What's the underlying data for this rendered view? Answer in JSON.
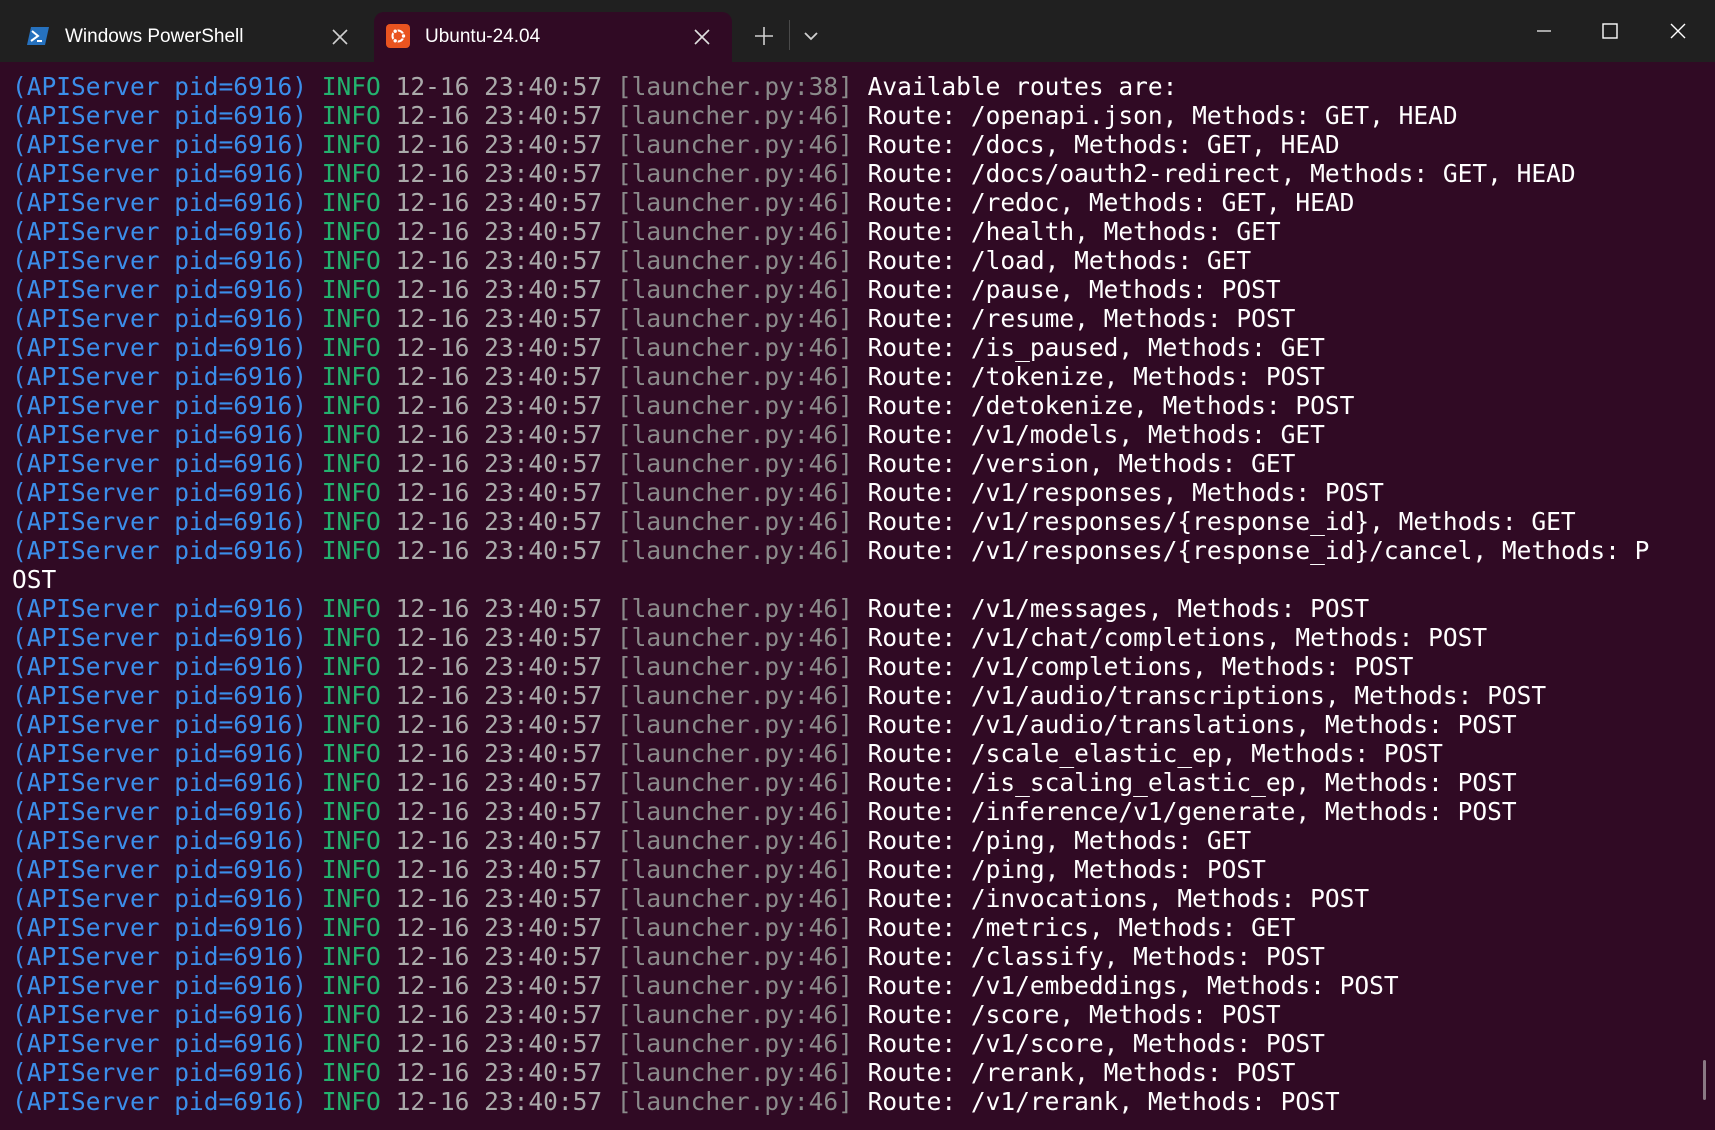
{
  "tabs": [
    {
      "label": "Windows PowerShell",
      "icon": "powershell-icon",
      "active": false
    },
    {
      "label": "Ubuntu-24.04",
      "icon": "ubuntu-icon",
      "active": true
    }
  ],
  "titlebar": {
    "new_tab_icon": "plus-icon",
    "dropdown_icon": "chevron-down-icon",
    "controls": [
      "minimize-icon",
      "maximize-icon",
      "close-icon"
    ]
  },
  "colors": {
    "terminal_bg": "#300a24",
    "titlebar_bg": "#202020",
    "source": "#3b8eea",
    "level": "#23b26e",
    "timestamp": "#aaaaaa",
    "location": "#8b8b8b",
    "message": "#ffffff"
  },
  "log": {
    "source": "(APIServer pid=6916)",
    "level": "INFO",
    "timestamp": "12-16 23:40:57",
    "lines": [
      {
        "location": "[launcher.py:38]",
        "message": "Available routes are:"
      },
      {
        "location": "[launcher.py:46]",
        "message": "Route: /openapi.json, Methods: GET, HEAD"
      },
      {
        "location": "[launcher.py:46]",
        "message": "Route: /docs, Methods: GET, HEAD"
      },
      {
        "location": "[launcher.py:46]",
        "message": "Route: /docs/oauth2-redirect, Methods: GET, HEAD"
      },
      {
        "location": "[launcher.py:46]",
        "message": "Route: /redoc, Methods: GET, HEAD"
      },
      {
        "location": "[launcher.py:46]",
        "message": "Route: /health, Methods: GET"
      },
      {
        "location": "[launcher.py:46]",
        "message": "Route: /load, Methods: GET"
      },
      {
        "location": "[launcher.py:46]",
        "message": "Route: /pause, Methods: POST"
      },
      {
        "location": "[launcher.py:46]",
        "message": "Route: /resume, Methods: POST"
      },
      {
        "location": "[launcher.py:46]",
        "message": "Route: /is_paused, Methods: GET"
      },
      {
        "location": "[launcher.py:46]",
        "message": "Route: /tokenize, Methods: POST"
      },
      {
        "location": "[launcher.py:46]",
        "message": "Route: /detokenize, Methods: POST"
      },
      {
        "location": "[launcher.py:46]",
        "message": "Route: /v1/models, Methods: GET"
      },
      {
        "location": "[launcher.py:46]",
        "message": "Route: /version, Methods: GET"
      },
      {
        "location": "[launcher.py:46]",
        "message": "Route: /v1/responses, Methods: POST"
      },
      {
        "location": "[launcher.py:46]",
        "message": "Route: /v1/responses/{response_id}, Methods: GET"
      },
      {
        "location": "[launcher.py:46]",
        "message": "Route: /v1/responses/{response_id}/cancel, Methods: P",
        "wrap": "OST"
      },
      {
        "location": "[launcher.py:46]",
        "message": "Route: /v1/messages, Methods: POST"
      },
      {
        "location": "[launcher.py:46]",
        "message": "Route: /v1/chat/completions, Methods: POST"
      },
      {
        "location": "[launcher.py:46]",
        "message": "Route: /v1/completions, Methods: POST"
      },
      {
        "location": "[launcher.py:46]",
        "message": "Route: /v1/audio/transcriptions, Methods: POST"
      },
      {
        "location": "[launcher.py:46]",
        "message": "Route: /v1/audio/translations, Methods: POST"
      },
      {
        "location": "[launcher.py:46]",
        "message": "Route: /scale_elastic_ep, Methods: POST"
      },
      {
        "location": "[launcher.py:46]",
        "message": "Route: /is_scaling_elastic_ep, Methods: POST"
      },
      {
        "location": "[launcher.py:46]",
        "message": "Route: /inference/v1/generate, Methods: POST"
      },
      {
        "location": "[launcher.py:46]",
        "message": "Route: /ping, Methods: GET"
      },
      {
        "location": "[launcher.py:46]",
        "message": "Route: /ping, Methods: POST"
      },
      {
        "location": "[launcher.py:46]",
        "message": "Route: /invocations, Methods: POST"
      },
      {
        "location": "[launcher.py:46]",
        "message": "Route: /metrics, Methods: GET"
      },
      {
        "location": "[launcher.py:46]",
        "message": "Route: /classify, Methods: POST"
      },
      {
        "location": "[launcher.py:46]",
        "message": "Route: /v1/embeddings, Methods: POST"
      },
      {
        "location": "[launcher.py:46]",
        "message": "Route: /score, Methods: POST"
      },
      {
        "location": "[launcher.py:46]",
        "message": "Route: /v1/score, Methods: POST"
      },
      {
        "location": "[launcher.py:46]",
        "message": "Route: /rerank, Methods: POST"
      },
      {
        "location": "[launcher.py:46]",
        "message": "Route: /v1/rerank, Methods: POST"
      }
    ]
  }
}
